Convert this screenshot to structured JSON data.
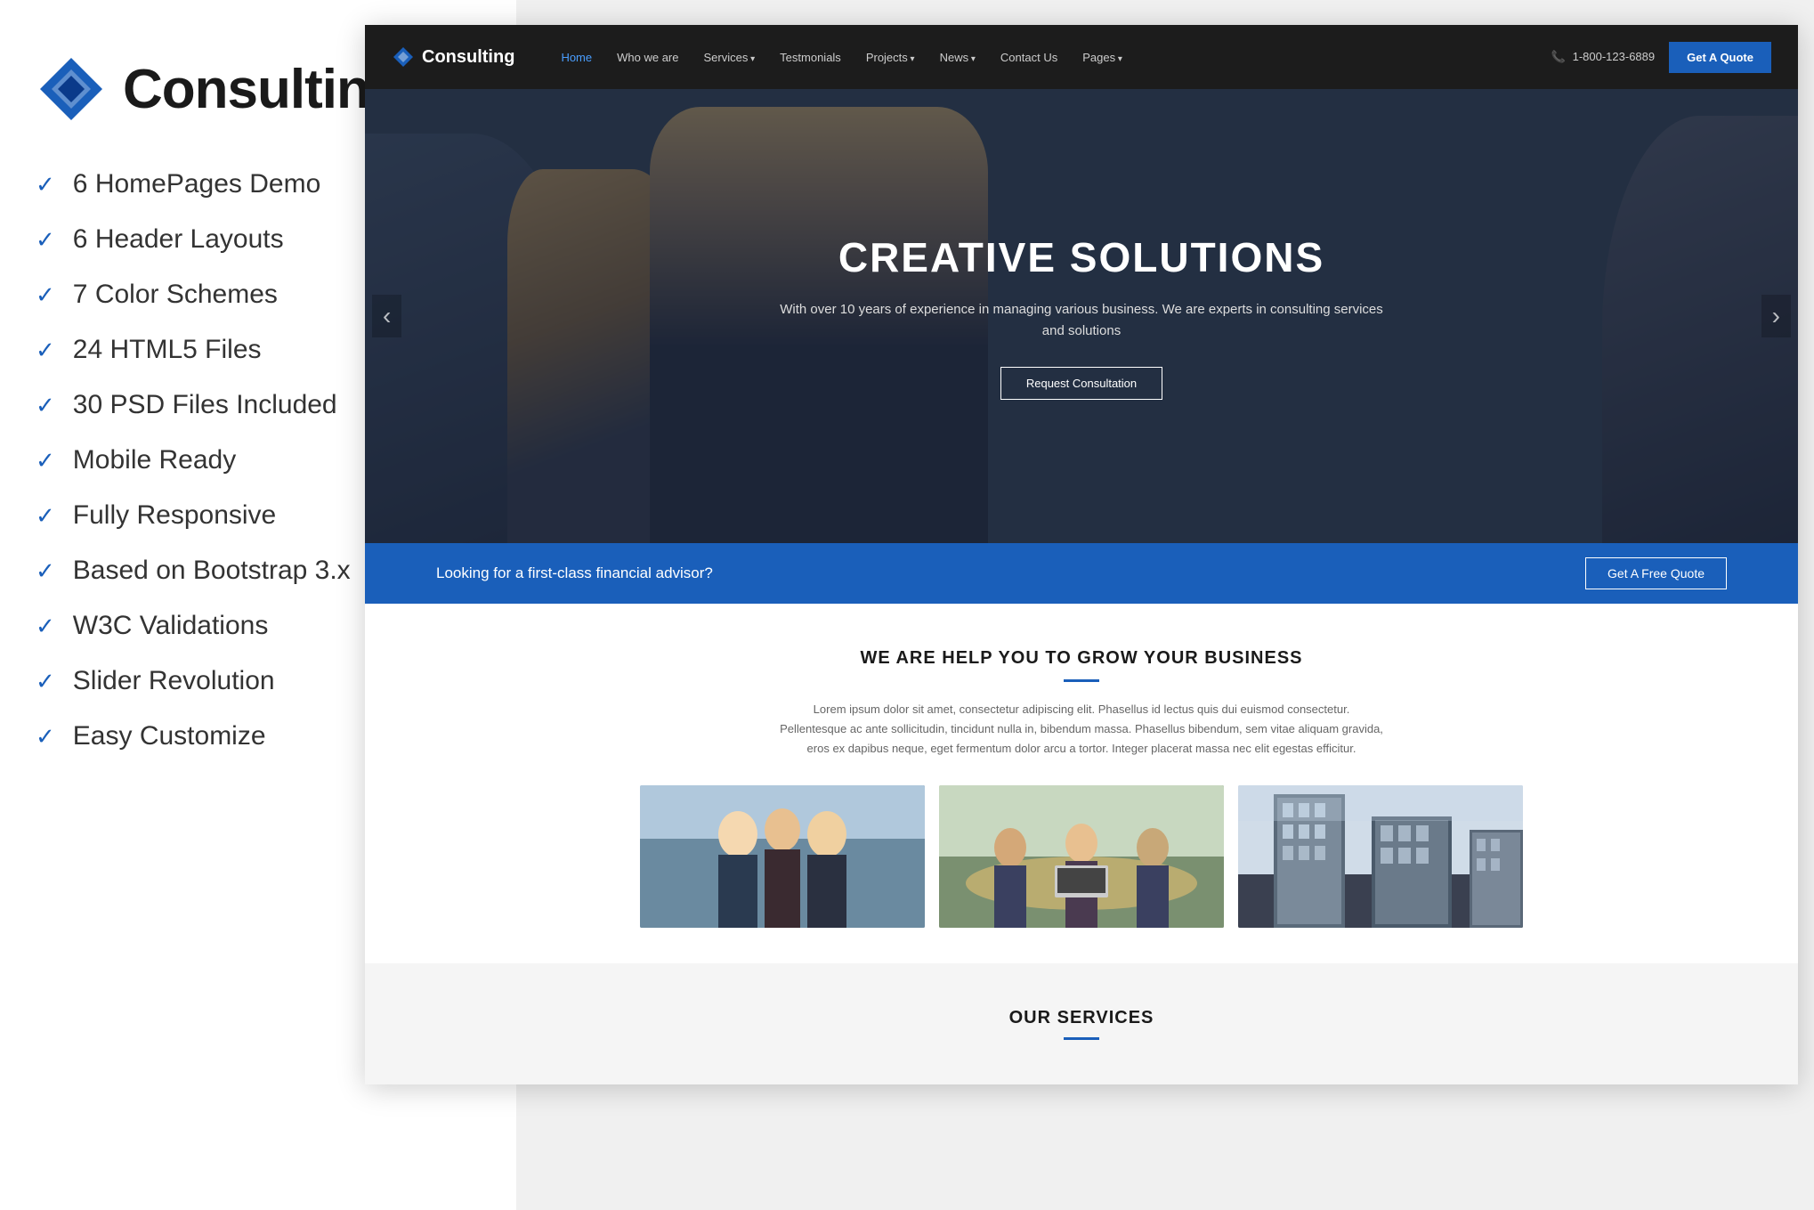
{
  "brand": {
    "name": "Consulting",
    "logo_alt": "Consulting diamond logo"
  },
  "features": [
    "6 HomePages Demo",
    "6 Header Layouts",
    "7 Color Schemes",
    "24 HTML5 Files",
    "30 PSD Files Included",
    "Mobile Ready",
    "Fully Responsive",
    "Based on Bootstrap 3.x",
    "W3C Validations",
    "Slider Revolution",
    "Easy Customize"
  ],
  "site": {
    "logo_text": "Consulting",
    "nav": {
      "home": "Home",
      "who_we_are": "Who we are",
      "services": "Services",
      "testimonials": "Testmonials",
      "projects": "Projects",
      "news": "News",
      "contact_us": "Contact Us",
      "pages": "Pages"
    },
    "phone": "1-800-123-6889",
    "get_quote_btn": "Get A Quote"
  },
  "hero": {
    "title": "CREATIVE SOLUTIONS",
    "subtitle": "With over 10 years of experience in managing various business. We are experts in consulting services and solutions",
    "cta_btn": "Request Consultation",
    "prev_arrow": "‹",
    "next_arrow": "›"
  },
  "banner": {
    "text": "Looking for a first-class financial advisor?",
    "btn": "Get A Free Quote"
  },
  "grow_section": {
    "title": "WE ARE HELP YOU TO GROW YOUR BUSINESS",
    "description": "Lorem ipsum dolor sit amet, consectetur adipiscing elit. Phasellus id lectus quis dui euismod consectetur. Pellentesque ac ante sollicitudin, tincidunt nulla in, bibendum massa. Phasellus bibendum, sem vitae aliquam gravida, eros ex dapibus neque, eget fermentum dolor arcu a tortor. Integer placerat massa nec elit egestas efficitur."
  },
  "services_section": {
    "title": "OUR SERVICES"
  },
  "colors": {
    "primary_blue": "#1a5fba",
    "dark": "#1c1c1c",
    "light_bg": "#f5f5f5"
  }
}
